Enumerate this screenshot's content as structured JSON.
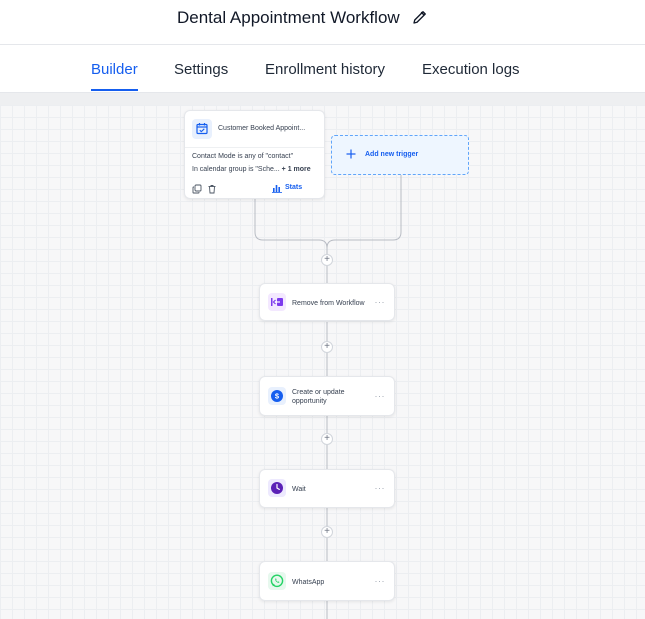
{
  "header": {
    "title": "Dental Appointment Workflow",
    "edit_icon": "pencil-icon"
  },
  "tabs": [
    {
      "label": "Builder",
      "active": true
    },
    {
      "label": "Settings",
      "active": false
    },
    {
      "label": "Enrollment history",
      "active": false
    },
    {
      "label": "Execution logs",
      "active": false
    }
  ],
  "trigger": {
    "icon": "calendar-check-icon",
    "title": "Customer Booked Appoint...",
    "conditions": [
      "Contact Mode is any of \"contact\"",
      "In calendar group is \"Sche..."
    ],
    "more_label": "+ 1 more",
    "stats_label": "Stats"
  },
  "add_trigger": {
    "label": "Add new trigger"
  },
  "actions": [
    {
      "label": "Remove from Workflow",
      "icon": "remove-from-workflow-icon",
      "color": "#7c3aed"
    },
    {
      "label": "Create or update opportunity",
      "icon": "dollar-icon",
      "color": "#155eef"
    },
    {
      "label": "Wait",
      "icon": "clock-icon",
      "color": "#5b21b6"
    },
    {
      "label": "WhatsApp",
      "icon": "whatsapp-icon",
      "color": "#25d366"
    }
  ],
  "node_menu_label": "···",
  "plus_label": "+",
  "colors": {
    "accent": "#155eef",
    "canvas": "#f7f7f8"
  }
}
